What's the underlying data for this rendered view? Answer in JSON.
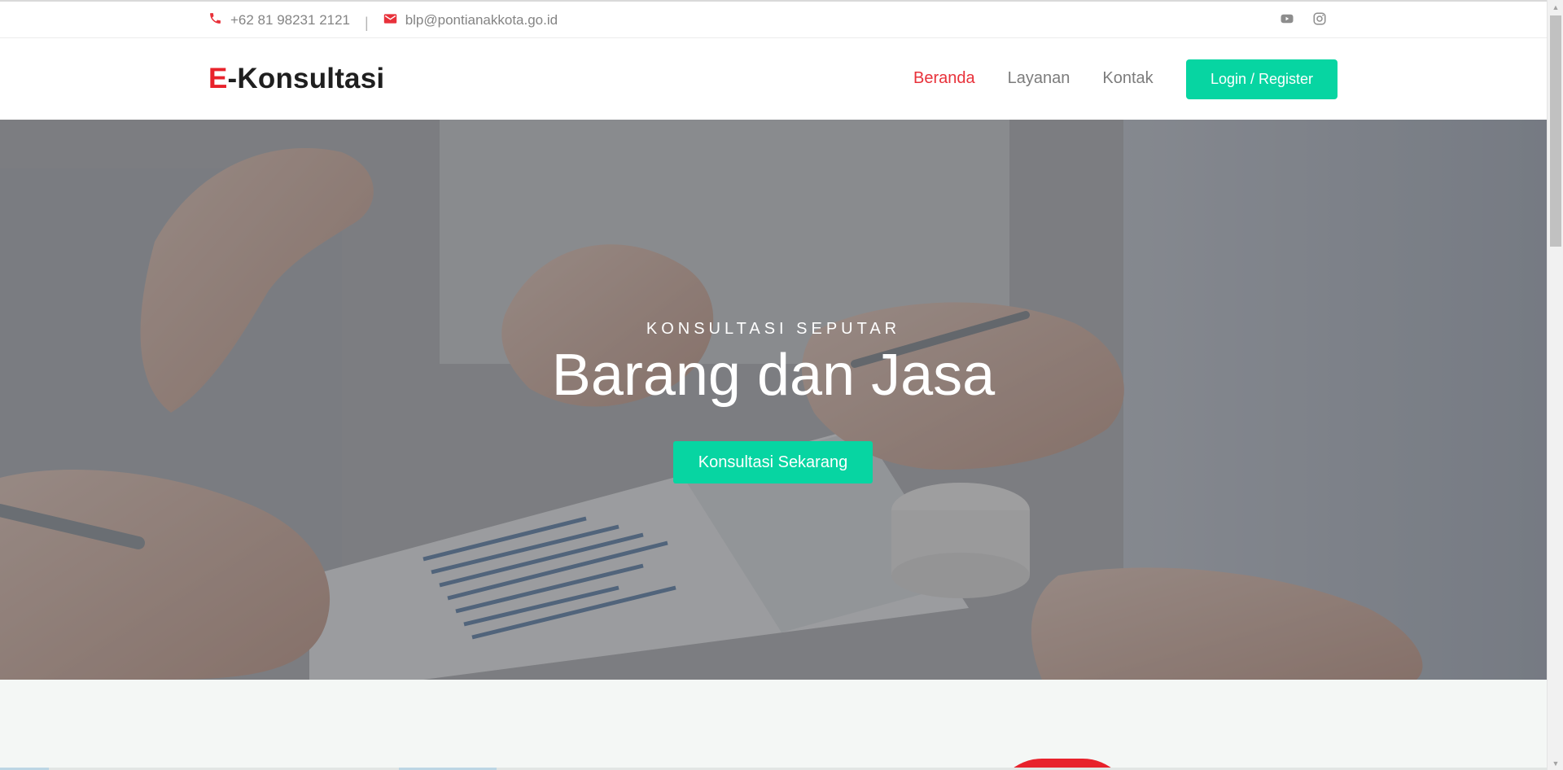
{
  "topbar": {
    "phone": "+62 81 98231 2121",
    "separator": "|",
    "email": "blp@pontianakkota.go.id",
    "social": [
      {
        "icon": "youtube-icon"
      },
      {
        "icon": "instagram-icon"
      }
    ]
  },
  "header": {
    "logo_accent": "E",
    "logo_rest": "-Konsultasi",
    "nav": [
      {
        "label": "Beranda",
        "active": true
      },
      {
        "label": "Layanan",
        "active": false
      },
      {
        "label": "Kontak",
        "active": false
      }
    ],
    "login_label": "Login / Register"
  },
  "hero": {
    "subtitle": "KONSULTASI SEPUTAR",
    "title": "Barang dan Jasa",
    "cta_label": "Konsultasi Sekarang"
  },
  "colors": {
    "accent_green": "#07d5a2",
    "accent_red": "#e8222b",
    "nav_active": "#e8313a",
    "text_muted": "#7c7c7c"
  }
}
